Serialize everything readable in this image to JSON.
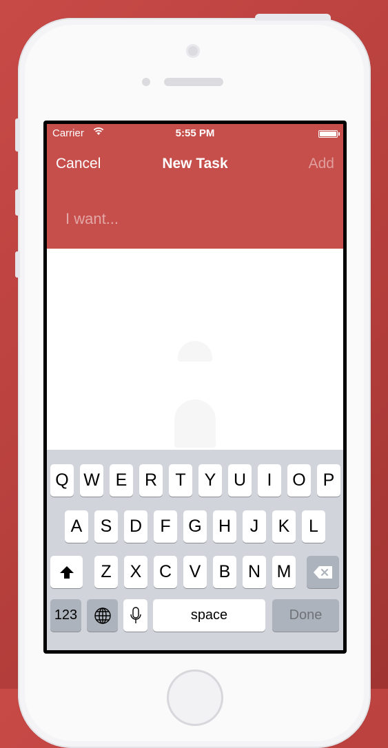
{
  "status_bar": {
    "carrier": "Carrier",
    "time": "5:55 PM"
  },
  "nav": {
    "cancel_label": "Cancel",
    "title": "New Task",
    "add_label": "Add"
  },
  "task_input": {
    "placeholder": "I want...",
    "value": ""
  },
  "colors": {
    "header_bg": "#c64f4c",
    "page_bg": "#b43e3b",
    "keyboard_bg": "#d1d5db"
  },
  "keyboard": {
    "row1": [
      "Q",
      "W",
      "E",
      "R",
      "T",
      "Y",
      "U",
      "I",
      "O",
      "P"
    ],
    "row2": [
      "A",
      "S",
      "D",
      "F",
      "G",
      "H",
      "J",
      "K",
      "L"
    ],
    "row3": [
      "Z",
      "X",
      "C",
      "V",
      "B",
      "N",
      "M"
    ],
    "numbers_label": "123",
    "space_label": "space",
    "done_label": "Done",
    "icons": [
      "shift-icon",
      "backspace-icon",
      "globe-icon",
      "microphone-icon"
    ]
  }
}
